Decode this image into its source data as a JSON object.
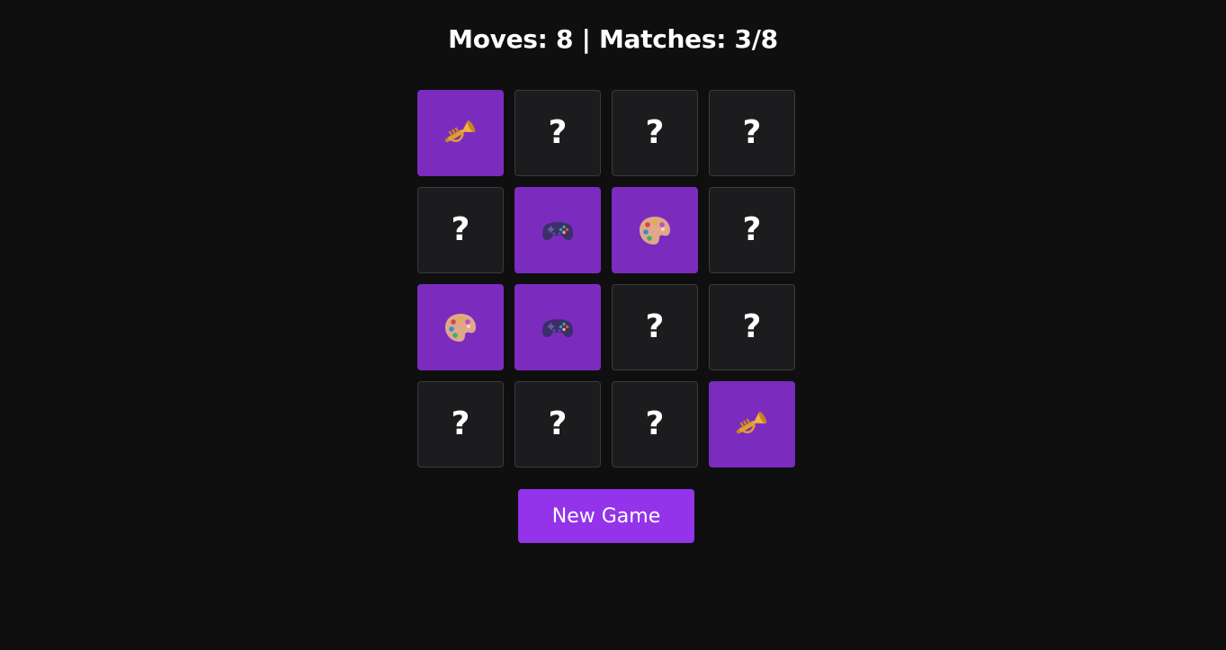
{
  "status": {
    "text": "Moves: 8 | Matches: 3/8",
    "moves": 8,
    "matches": 3,
    "total_pairs": 8
  },
  "colors": {
    "background": "#0f0f0f",
    "card_hidden": "#1c1c1e",
    "card_hidden_border": "#3a3a3e",
    "card_matched": "#7b2cbf",
    "button": "#9333ea"
  },
  "board": {
    "rows": 4,
    "cols": 4,
    "hidden_symbol": "?",
    "cards": [
      {
        "state": "matched",
        "icon": "trumpet-icon"
      },
      {
        "state": "hidden",
        "icon": null
      },
      {
        "state": "hidden",
        "icon": null
      },
      {
        "state": "hidden",
        "icon": null
      },
      {
        "state": "hidden",
        "icon": null
      },
      {
        "state": "matched",
        "icon": "game-controller-icon"
      },
      {
        "state": "matched",
        "icon": "artist-palette-icon"
      },
      {
        "state": "hidden",
        "icon": null
      },
      {
        "state": "matched",
        "icon": "artist-palette-icon"
      },
      {
        "state": "matched",
        "icon": "game-controller-icon"
      },
      {
        "state": "hidden",
        "icon": null
      },
      {
        "state": "hidden",
        "icon": null
      },
      {
        "state": "hidden",
        "icon": null
      },
      {
        "state": "hidden",
        "icon": null
      },
      {
        "state": "hidden",
        "icon": null
      },
      {
        "state": "matched",
        "icon": "trumpet-icon"
      }
    ]
  },
  "new_game_button": {
    "label": "New Game"
  }
}
